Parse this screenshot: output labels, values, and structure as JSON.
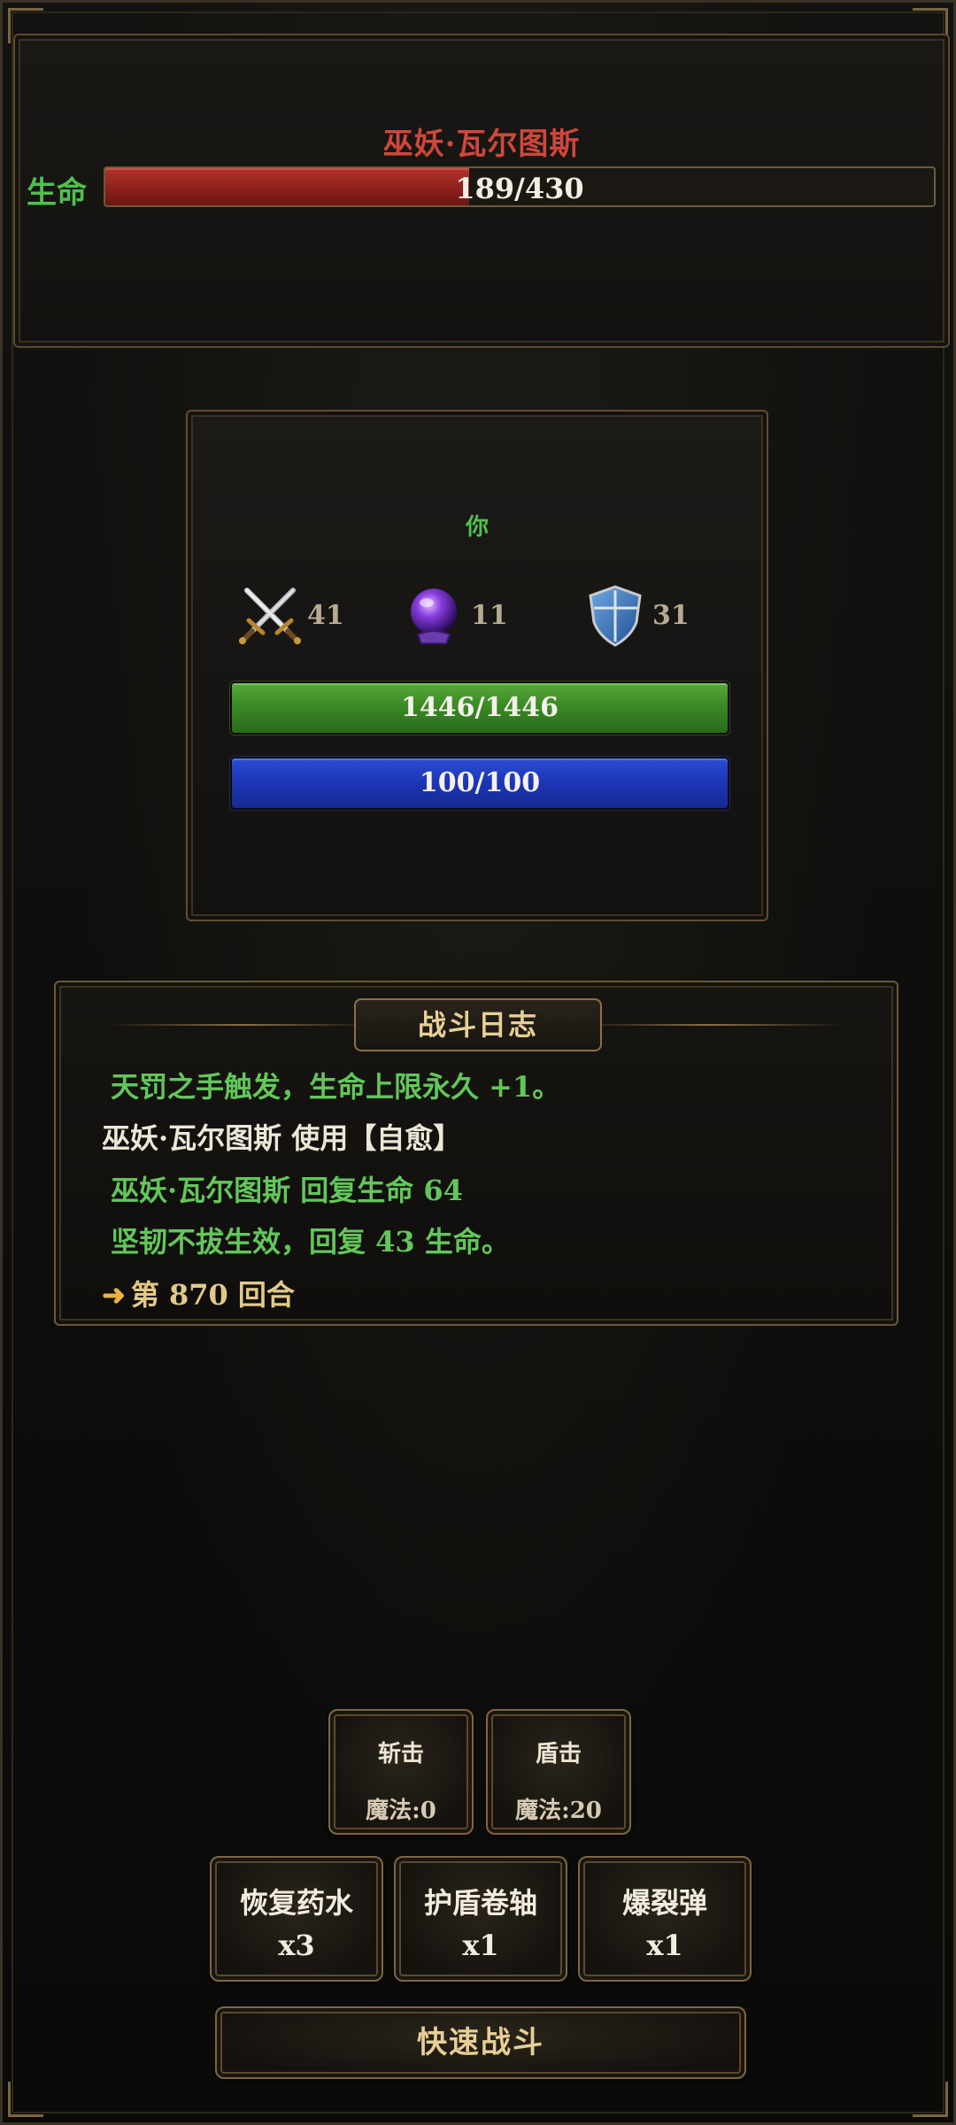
{
  "enemy": {
    "name": "巫妖·瓦尔图斯",
    "hp_label": "生命",
    "hp_text": "189/430",
    "hp_current": 189,
    "hp_max": 430
  },
  "player": {
    "name": "你",
    "attack": "41",
    "magic": "11",
    "defense": "31",
    "hp_text": "1446/1446",
    "mp_text": "100/100",
    "icons": {
      "attack": "crossed-swords-icon",
      "magic": "crystal-orb-icon",
      "defense": "shield-icon"
    }
  },
  "log": {
    "title": "战斗日志",
    "lines": [
      {
        "text": "天罚之手触发，生命上限永久 +1。"
      },
      {
        "text": "巫妖·瓦尔图斯 使用【自愈】"
      },
      {
        "text": "巫妖·瓦尔图斯 回复生命 64"
      },
      {
        "text": "坚韧不拔生效，回复 43 生命。"
      },
      {
        "text": "第 870 回合"
      }
    ]
  },
  "skills": [
    {
      "name": "斩击",
      "cost": "魔法:0"
    },
    {
      "name": "盾击",
      "cost": "魔法:20"
    }
  ],
  "items": [
    {
      "name": "恢复药水",
      "qty": "x3"
    },
    {
      "name": "护盾卷轴",
      "qty": "x1"
    },
    {
      "name": "爆裂弹",
      "qty": "x1"
    }
  ],
  "quick_battle": "快速战斗",
  "colors": {
    "enemy_name": "#d0473a",
    "hp_green": "#4ec24a",
    "enemy_hp_fill": "#8a1f1a",
    "player_hp_fill": "#3b8a26",
    "player_mp_fill": "#1d36b8",
    "gold_text": "#e7cf95"
  }
}
